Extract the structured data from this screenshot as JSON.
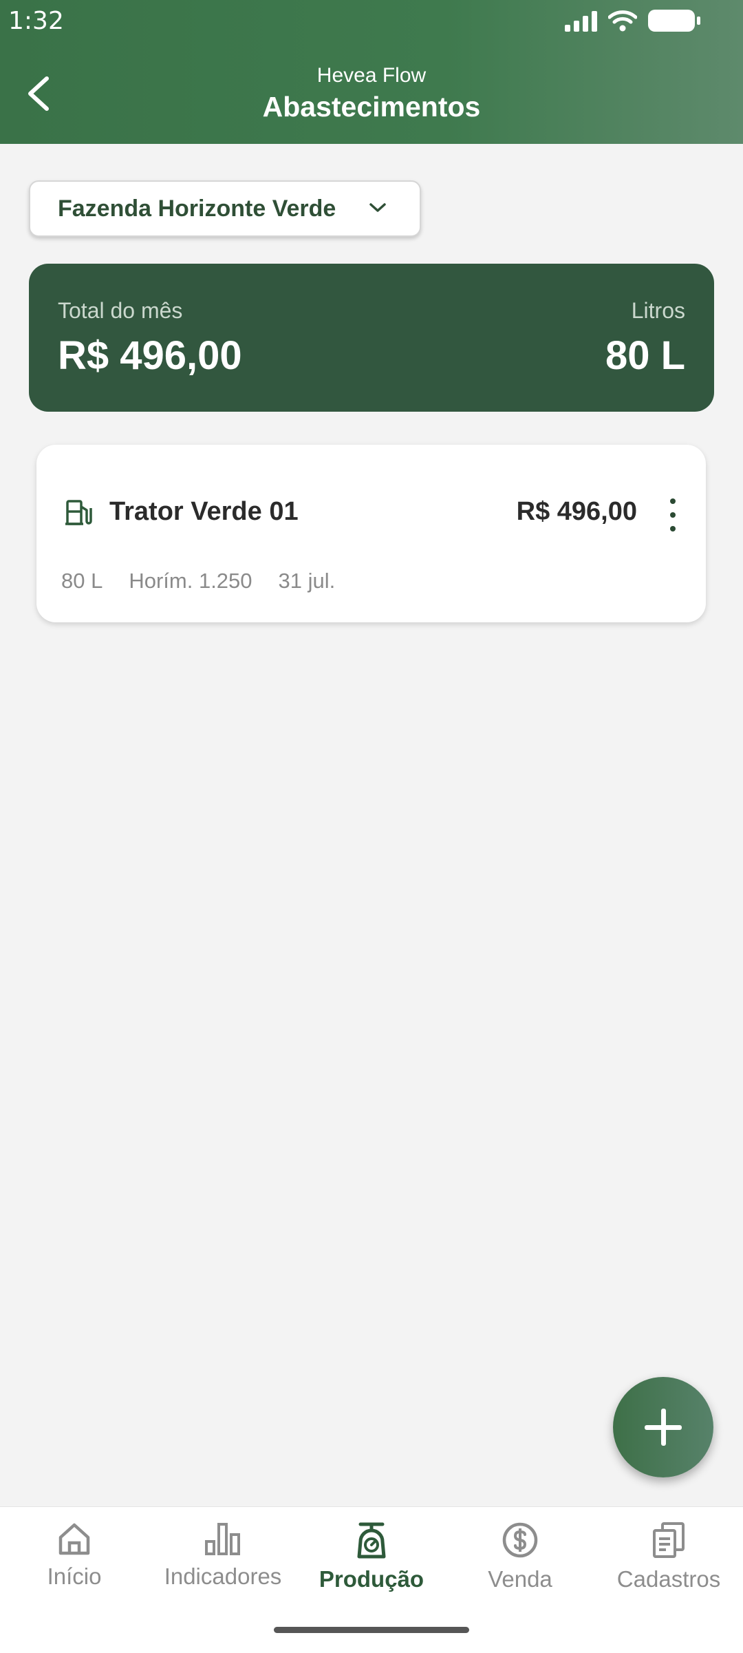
{
  "status_bar": {
    "time": "1:32"
  },
  "header": {
    "app_name": "Hevea Flow",
    "title": "Abastecimentos"
  },
  "farm_selector": {
    "value": "Fazenda Horizonte Verde"
  },
  "summary": {
    "total_label": "Total do mês",
    "total_value": "R$ 496,00",
    "liters_label": "Litros",
    "liters_value": "80 L"
  },
  "entries": [
    {
      "name": "Trator Verde 01",
      "amount": "R$ 496,00",
      "liters": "80 L",
      "hourmeter": "Horím. 1.250",
      "date": "31 jul."
    }
  ],
  "bottom_nav": {
    "items": [
      {
        "label": "Início",
        "icon": "home-icon"
      },
      {
        "label": "Indicadores",
        "icon": "bar-chart-icon"
      },
      {
        "label": "Produção",
        "icon": "scale-icon",
        "active": true
      },
      {
        "label": "Venda",
        "icon": "dollar-circle-icon"
      },
      {
        "label": "Cadastros",
        "icon": "documents-icon"
      }
    ]
  },
  "colors": {
    "primary": "#3a7248",
    "summary_bg": "#32573f",
    "background": "#f3f3f3"
  }
}
